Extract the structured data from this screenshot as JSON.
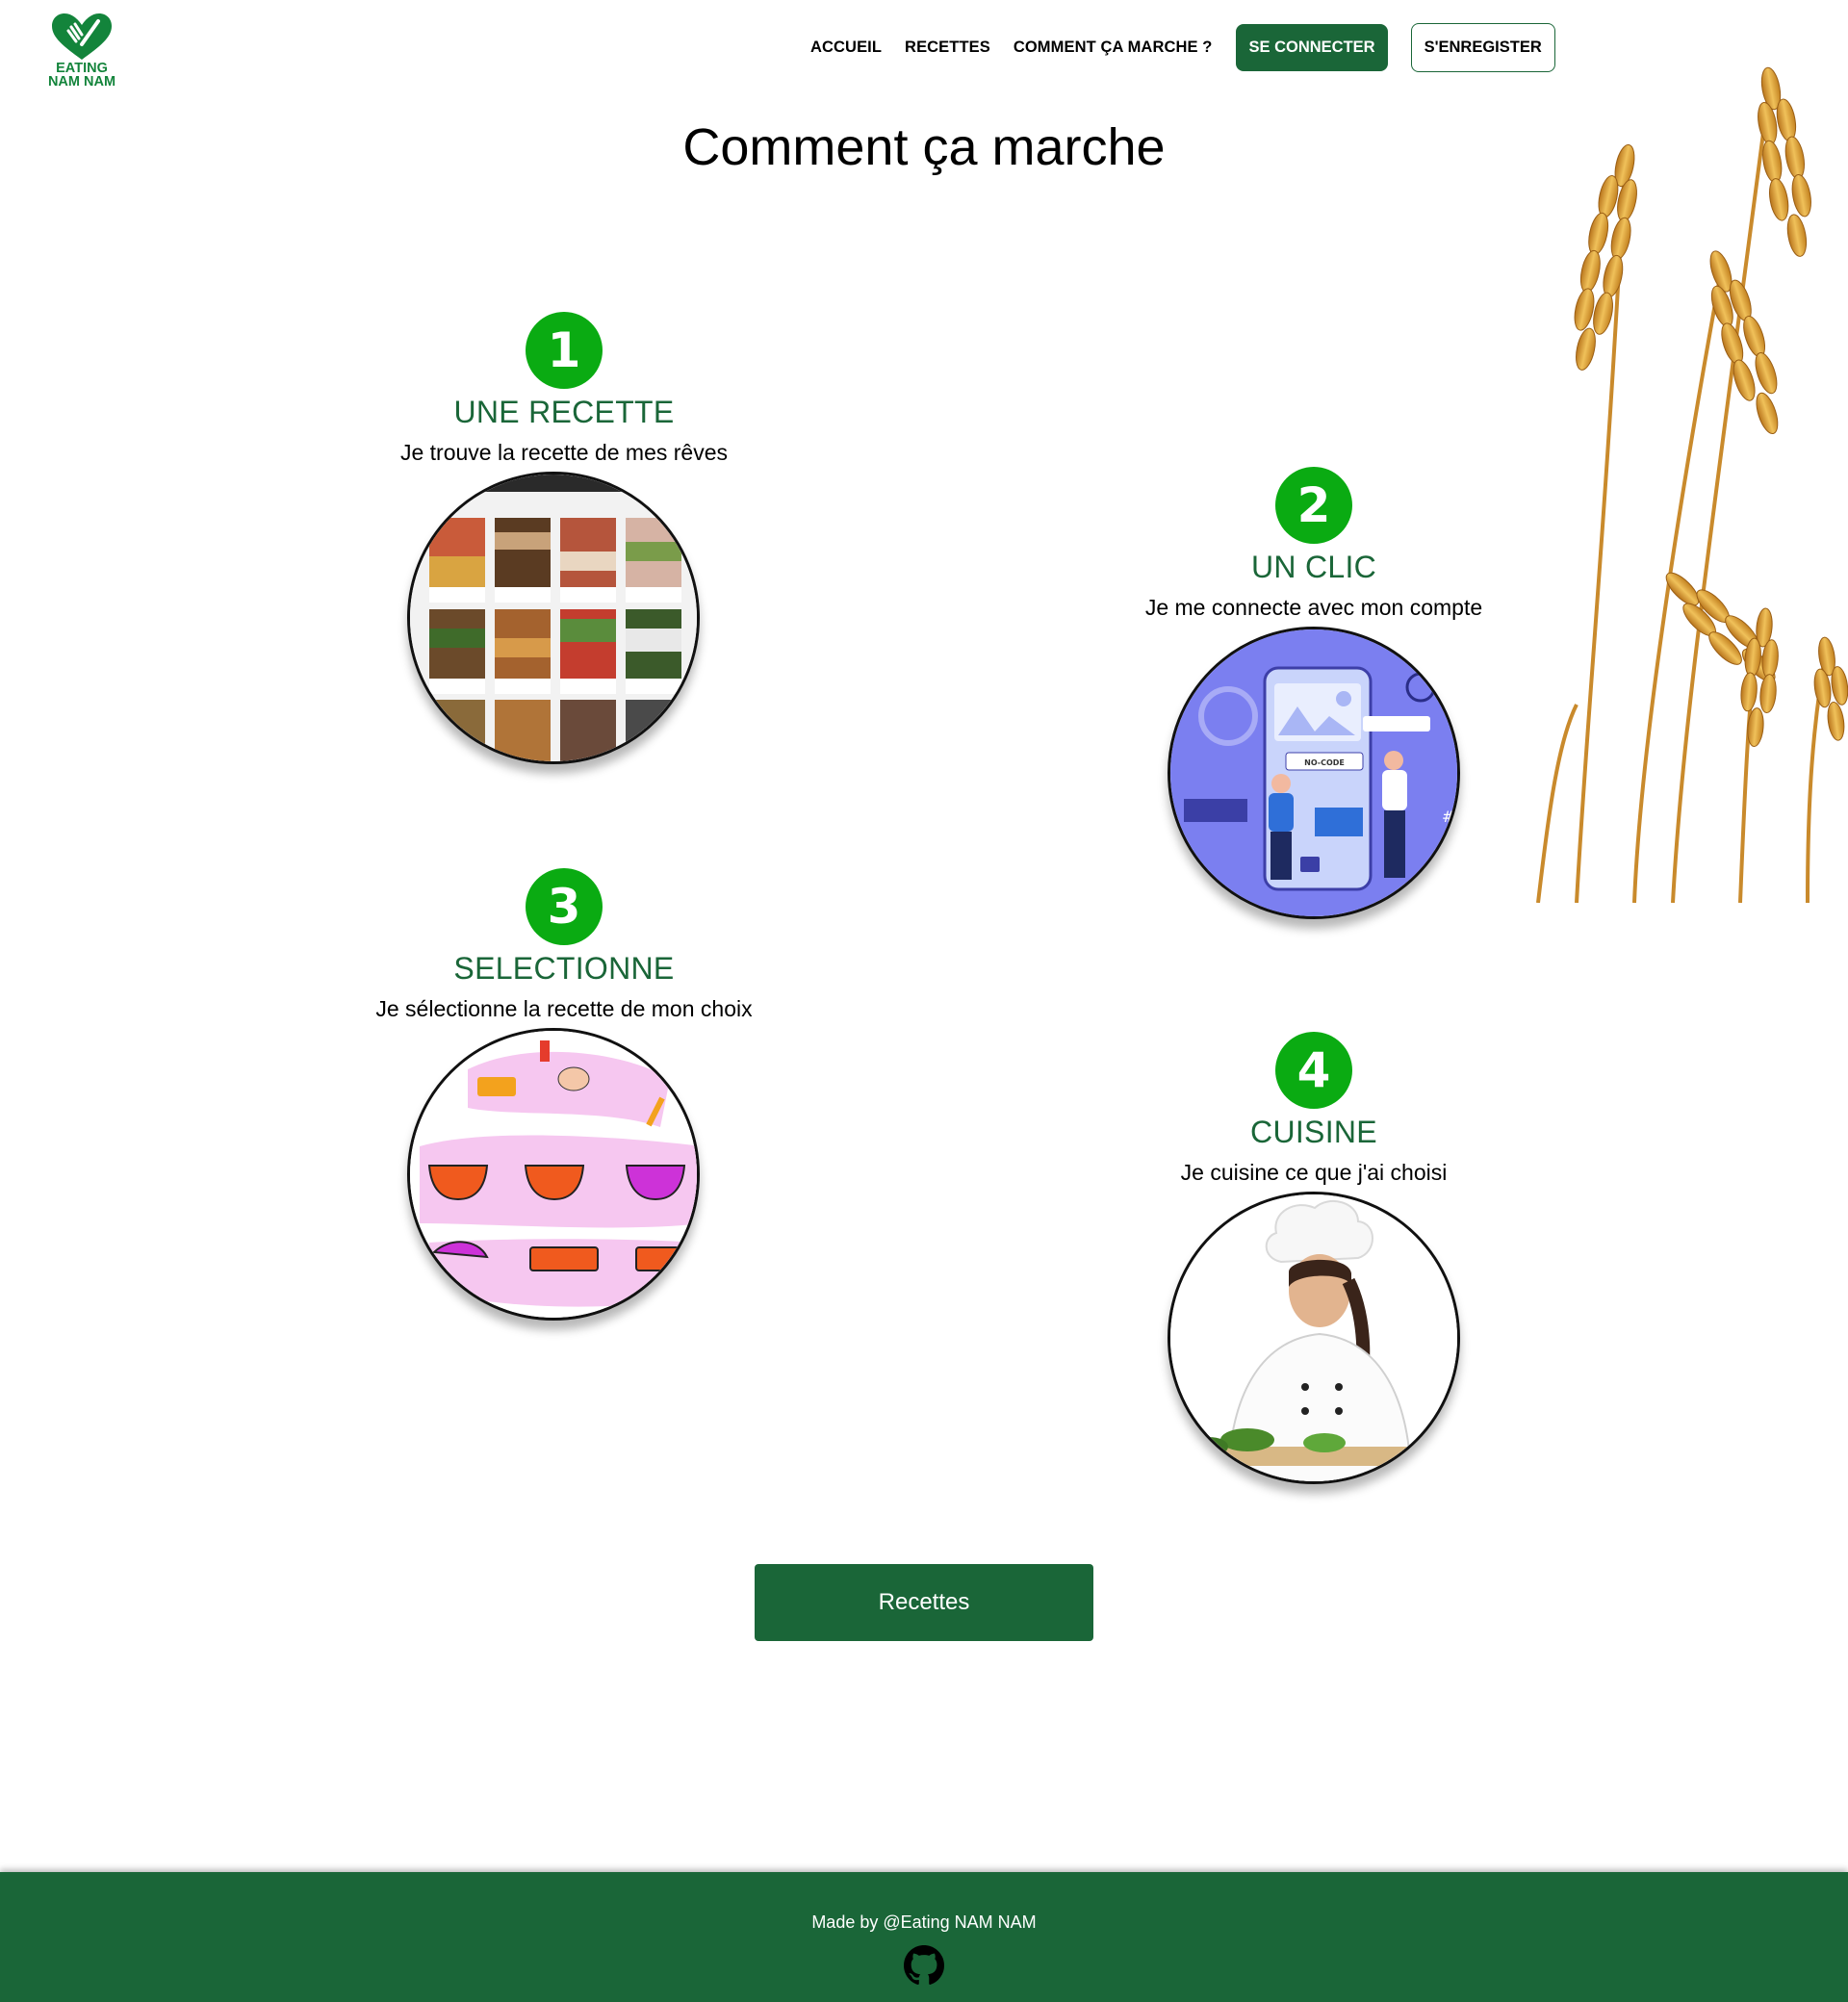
{
  "brand": {
    "line1": "EATING",
    "line2": "NAM NAM",
    "color": "#13843b"
  },
  "nav": {
    "items": [
      {
        "label": "ACCUEIL"
      },
      {
        "label": "RECETTES"
      },
      {
        "label": "COMMENT ÇA MARCHE ?"
      }
    ],
    "login_label": "SE CONNECTER",
    "register_label": "S'ENREGISTER"
  },
  "page": {
    "title": "Comment ça marche"
  },
  "steps": [
    {
      "number": "1",
      "title": "UNE RECETTE",
      "description": "Je trouve la recette de mes rêves",
      "image": "recipe-grid-screenshot"
    },
    {
      "number": "2",
      "title": "UN CLIC",
      "description": "Je me connecte avec mon compte",
      "image": "no-code-app-illustration",
      "image_label": "NO-CODE"
    },
    {
      "number": "3",
      "title": "SELECTIONNE",
      "description": "Je sélectionne la recette de mon choix",
      "image": "recipe-steps-drawing"
    },
    {
      "number": "4",
      "title": "CUISINE",
      "description": "Je cuisine ce que j'ai choisi",
      "image": "chef-photo"
    }
  ],
  "cta": {
    "label": "Recettes"
  },
  "footer": {
    "text": "Made by @Eating NAM NAM",
    "icon": "github-icon"
  },
  "colors": {
    "primary": "#1a6638",
    "badge": "#0aab12",
    "title_green": "#1a6638"
  }
}
